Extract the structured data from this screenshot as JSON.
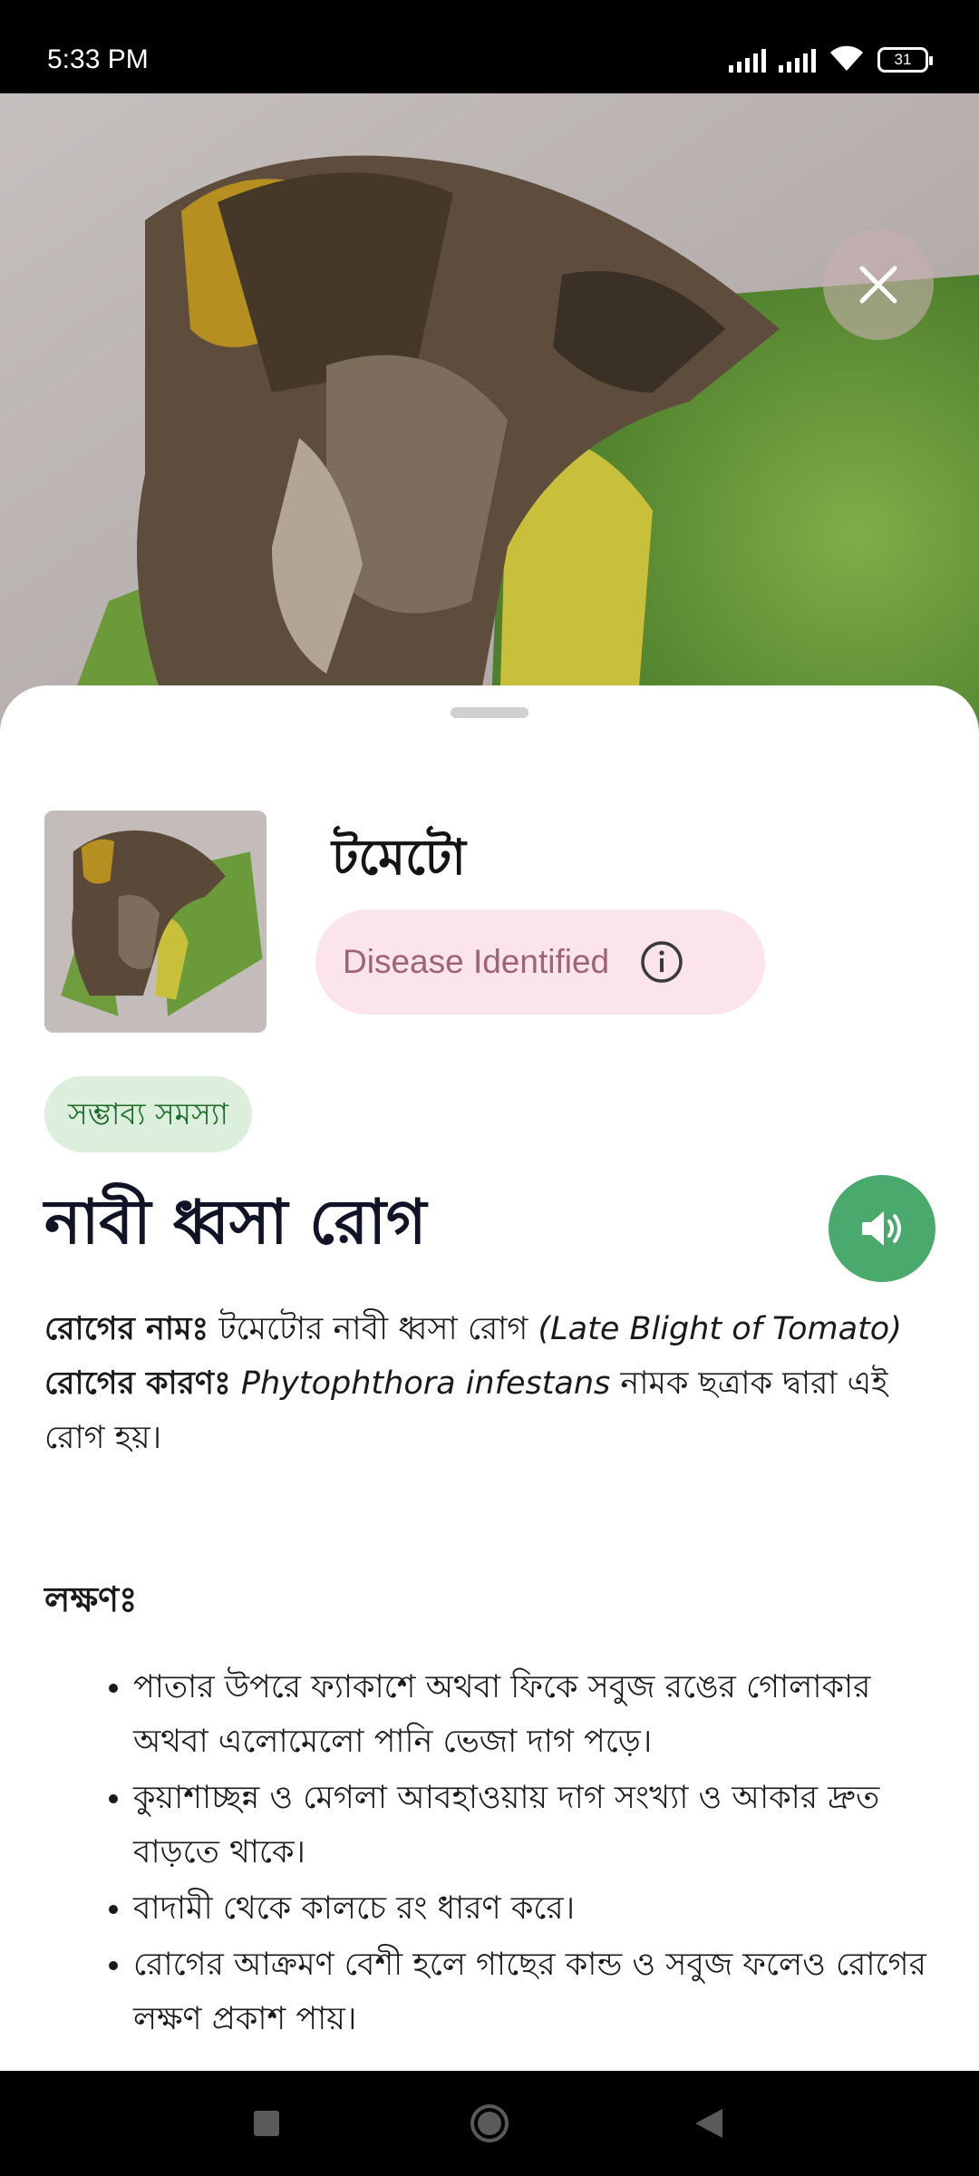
{
  "status_bar": {
    "time": "5:33 PM",
    "battery": "31",
    "icons": [
      "signal-icon",
      "signal-icon",
      "wifi-icon",
      "battery-icon"
    ]
  },
  "hero": {
    "close_icon": "close-icon"
  },
  "result": {
    "crop_name": "টমেটো",
    "status_label": "Disease Identified",
    "status_icon": "info-icon",
    "problem_chip": "সম্ভাব্য সমস্যা",
    "disease_title": "নাবী ধ্বসা রোগ",
    "speaker_icon": "speaker-icon"
  },
  "details": {
    "name_label": "রোগের নামঃ",
    "name_text": " টমেটোর নাবী ধ্বসা রোগ ",
    "name_latin": "(Late Blight of Tomato)",
    "cause_label": "রোগের কারণঃ",
    "cause_latin": " Phytophthora infestans",
    "cause_text": " নামক ছত্রাক দ্বারা এই রোগ হয়।",
    "symptoms_heading": "লক্ষণঃ",
    "symptoms": [
      "পাতার উপরে ফ্যাকাশে অথবা ফিকে সবুজ রঙের গোলাকার অথবা এলোমেলো পানি ভেজা দাগ পড়ে।",
      "কুয়াশাচ্ছন্ন ও মেগলা আবহাওয়ায় দাগ সংখ্যা ও আকার দ্রুত বাড়তে থাকে।",
      "বাদামী থেকে কালচে রং ধারণ করে।",
      "রোগের আক্রমণ বেশী হলে গাছের কান্ড ও সবুজ ফলেও রোগের লক্ষণ প্রকাশ পায়।"
    ]
  },
  "nav_bar": {
    "buttons": [
      "recents-icon",
      "home-icon",
      "back-icon"
    ]
  },
  "colors": {
    "accent_green": "#4aa96c",
    "chip_pink": "#fce4ec",
    "chip_pink_text": "#9d6478",
    "chip_green": "#dcefdc",
    "chip_green_text": "#1c6b28"
  }
}
